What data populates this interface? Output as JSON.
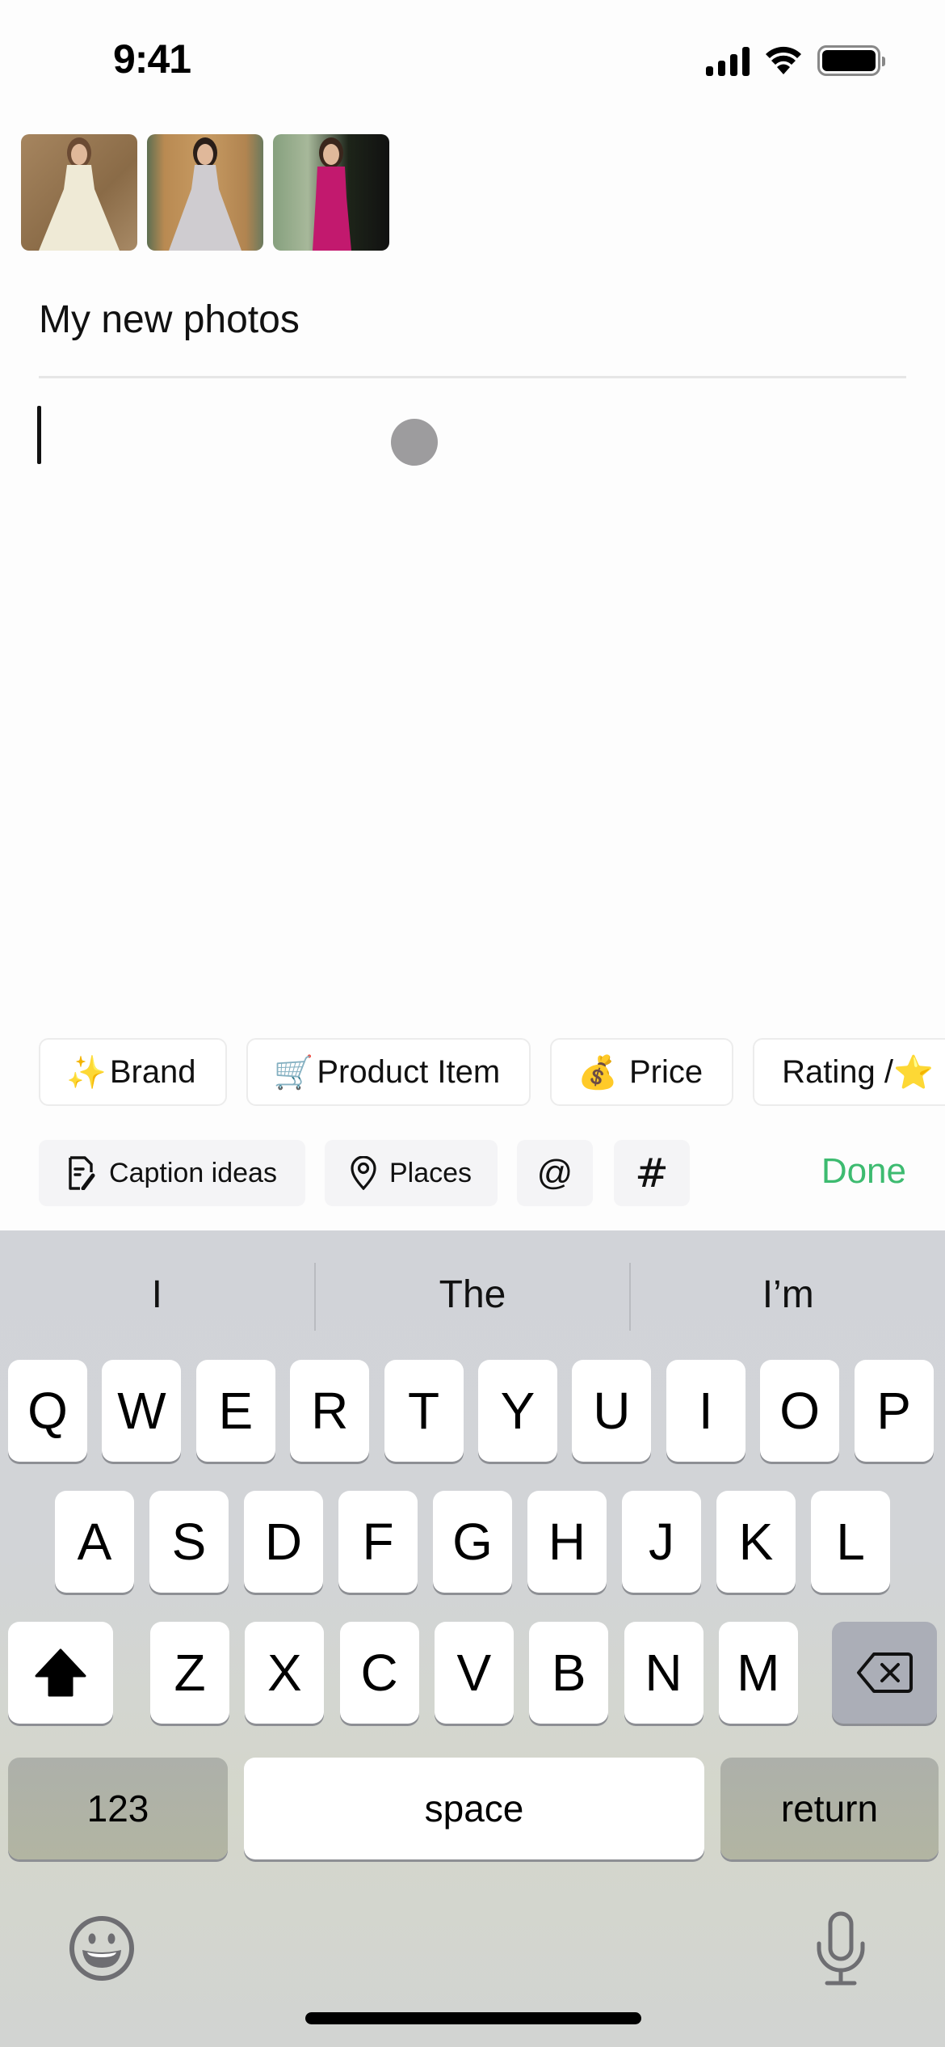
{
  "status_bar": {
    "time": "9:41",
    "icons": [
      "cellular-signal-icon",
      "wifi-icon",
      "battery-icon"
    ]
  },
  "photos": {
    "thumbnails": [
      {
        "description": "Woman in ivory satin gown"
      },
      {
        "description": "Woman in silver satin gown by wooden door"
      },
      {
        "description": "Woman in magenta satin dress"
      }
    ]
  },
  "post": {
    "title": "My new photos",
    "body_value": "",
    "cursor_visible": true
  },
  "tag_chips": [
    {
      "emoji": "✨",
      "icon": "sparkles-icon",
      "label": "Brand"
    },
    {
      "emoji": "🛒",
      "icon": "shopping-cart-icon",
      "label": "Product Item"
    },
    {
      "emoji": "💰",
      "icon": "money-bag-icon",
      "label": "Price"
    },
    {
      "emoji": "⭐",
      "icon": "star-icon",
      "label": "Rating /"
    }
  ],
  "toolbar": {
    "caption_ideas": "Caption ideas",
    "places": "Places",
    "mention": "@",
    "hashtag": "#",
    "done": "Done",
    "accent_color": "#3dbb70"
  },
  "keyboard": {
    "suggestions": [
      "I",
      "The",
      "I’m"
    ],
    "row1": [
      "Q",
      "W",
      "E",
      "R",
      "T",
      "Y",
      "U",
      "I",
      "O",
      "P"
    ],
    "row2": [
      "A",
      "S",
      "D",
      "F",
      "G",
      "H",
      "J",
      "K",
      "L"
    ],
    "row3": [
      "Z",
      "X",
      "C",
      "V",
      "B",
      "N",
      "M"
    ],
    "numbers_key": "123",
    "space_key": "space",
    "return_key": "return",
    "shift_icon": "shift-icon",
    "delete_icon": "delete-icon",
    "emoji_icon": "emoji-icon",
    "mic_icon": "microphone-icon"
  }
}
